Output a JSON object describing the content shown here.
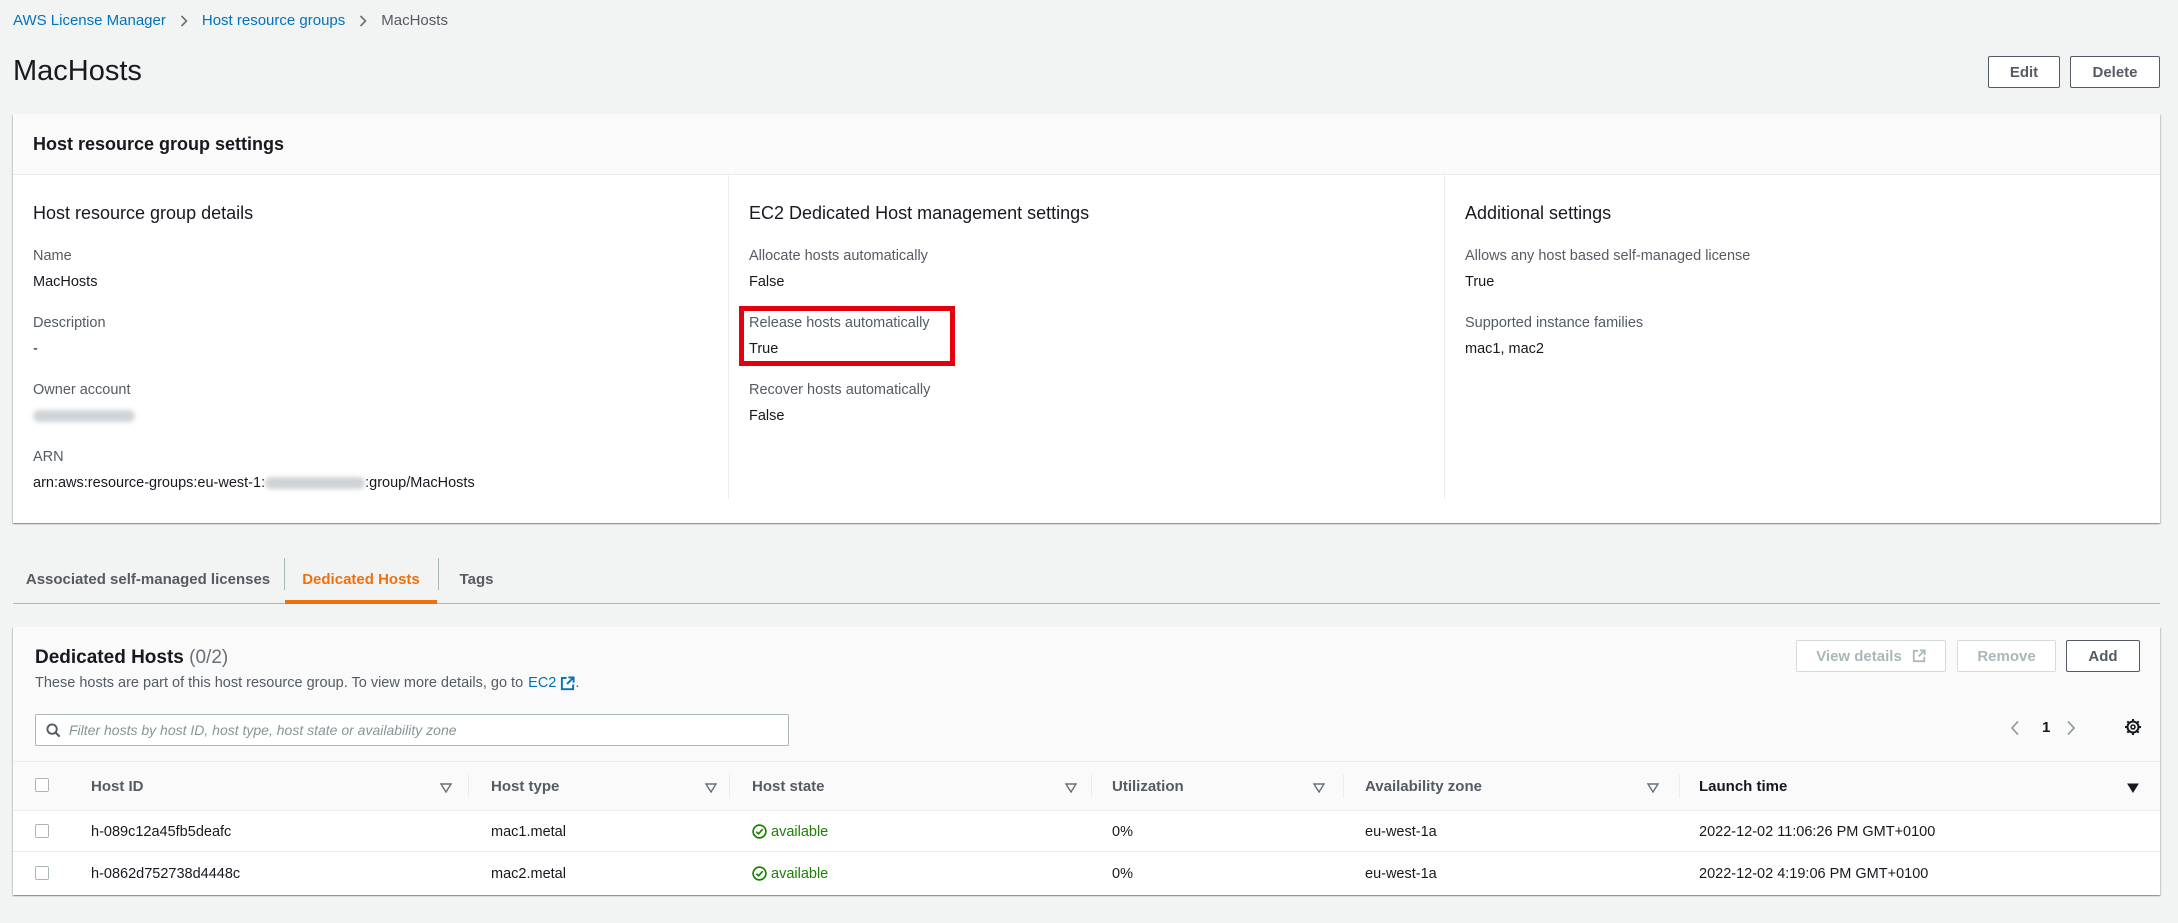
{
  "breadcrumb": {
    "items": [
      "AWS License Manager",
      "Host resource groups"
    ],
    "current": "MacHosts"
  },
  "page": {
    "title": "MacHosts",
    "edit_label": "Edit",
    "delete_label": "Delete"
  },
  "settings": {
    "header": "Host resource group settings",
    "details": {
      "heading": "Host resource group details",
      "name_label": "Name",
      "name_value": "MacHosts",
      "description_label": "Description",
      "description_value": "-",
      "owner_label": "Owner account",
      "arn_label": "ARN",
      "arn_prefix": "arn:aws:resource-groups:eu-west-1:",
      "arn_suffix": ":group/MacHosts"
    },
    "ec2": {
      "heading": "EC2 Dedicated Host management settings",
      "allocate_label": "Allocate hosts automatically",
      "allocate_value": "False",
      "release_label": "Release hosts automatically",
      "release_value": "True",
      "recover_label": "Recover hosts automatically",
      "recover_value": "False"
    },
    "additional": {
      "heading": "Additional settings",
      "allows_label": "Allows any host based self-managed license",
      "allows_value": "True",
      "families_label": "Supported instance families",
      "families_value": "mac1, mac2"
    }
  },
  "tabs": [
    "Associated self-managed licenses",
    "Dedicated Hosts",
    "Tags"
  ],
  "hosts": {
    "title": "Dedicated Hosts",
    "count": "(0/2)",
    "description": "These hosts are part of this host resource group. To view more details, go to",
    "ec2_link": "EC2",
    "description_end": ".",
    "view_details_label": "View details",
    "remove_label": "Remove",
    "add_label": "Add",
    "search_placeholder": "Filter hosts by host ID, host type, host state or availability zone",
    "current_page": "1",
    "columns": [
      "Host ID",
      "Host type",
      "Host state",
      "Utilization",
      "Availability zone",
      "Launch time"
    ],
    "rows": [
      {
        "id": "h-089c12a45fb5deafc",
        "type": "mac1.metal",
        "state": "available",
        "utilization": "0%",
        "zone": "eu-west-1a",
        "launch": "2022-12-02 11:06:26 PM GMT+0100"
      },
      {
        "id": "h-0862d752738d4448c",
        "type": "mac2.metal",
        "state": "available",
        "utilization": "0%",
        "zone": "eu-west-1a",
        "launch": "2022-12-02 4:19:06 PM GMT+0100"
      }
    ]
  },
  "colors": {
    "link": "#0073bb",
    "active_tab": "#ec7211",
    "success": "#1d8102",
    "highlight": "#e3000f"
  }
}
